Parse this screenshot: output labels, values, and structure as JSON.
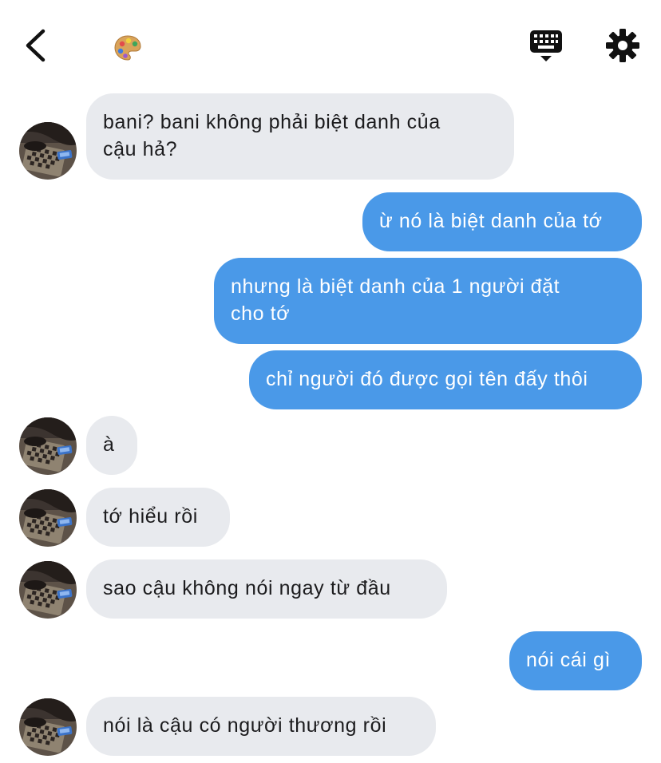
{
  "header": {
    "back_icon": "chevron-left-icon",
    "contact_icon": "artist-palette-icon",
    "keyboard_icon": "keyboard-icon",
    "settings_icon": "gear-icon"
  },
  "colors": {
    "incoming_bubble": "#e8eaee",
    "outgoing_bubble": "#4a99e8",
    "incoming_text": "#1c1c1e",
    "outgoing_text": "#ffffff"
  },
  "messages": [
    {
      "from": "them",
      "text": "bani? bani không phải biệt danh của\ncậu hả?"
    },
    {
      "from": "me",
      "text": "ừ nó là biệt danh của tớ"
    },
    {
      "from": "me",
      "text": "nhưng là biệt danh của 1 người đặt\ncho tớ"
    },
    {
      "from": "me",
      "text": "chỉ người đó được gọi tên đấy thôi"
    },
    {
      "from": "them",
      "text": "à"
    },
    {
      "from": "them",
      "text": "tớ hiểu rồi"
    },
    {
      "from": "them",
      "text": "sao cậu không nói ngay từ đầu"
    },
    {
      "from": "me",
      "text": "nói cái gì"
    },
    {
      "from": "them",
      "text": "nói là cậu có người thương rồi"
    }
  ]
}
